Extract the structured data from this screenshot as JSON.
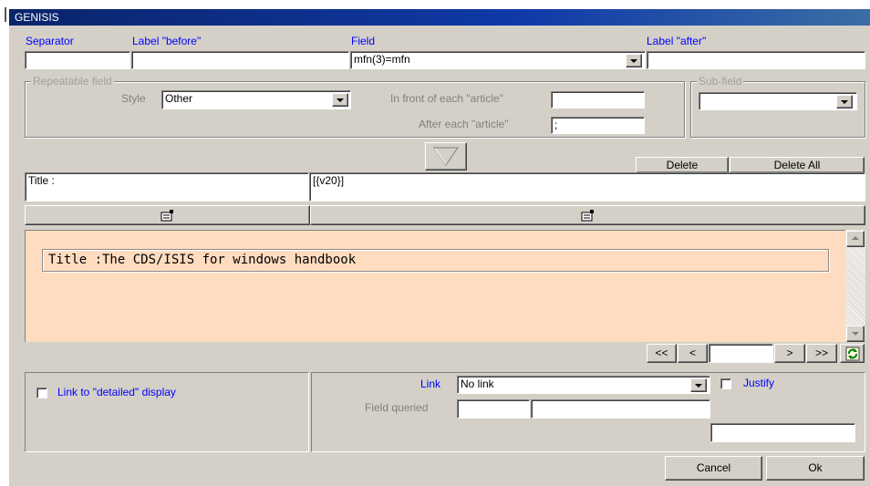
{
  "window": {
    "title": "GENISIS"
  },
  "labels": {
    "separator": "Separator",
    "label_before": "Label \"before\"",
    "field": "Field",
    "label_after": "Label \"after\""
  },
  "inputs": {
    "separator_value": "",
    "label_before_value": "",
    "field_value": "mfn(3)=mfn",
    "label_after_value": ""
  },
  "repeatable": {
    "legend": "Repeatable field",
    "style_label": "Style",
    "style_value": "Other",
    "in_front_label": "In front of each \"article\"",
    "in_front_value": "",
    "after_label": "After each \"article\"",
    "after_value": ";"
  },
  "subfield": {
    "legend": "Sub-field",
    "value": ""
  },
  "actions": {
    "delete": "Delete",
    "delete_all": "Delete All"
  },
  "row": {
    "label": "Title :",
    "format": "[{v20}]"
  },
  "preview": {
    "text": "Title :The CDS/ISIS for windows handbook"
  },
  "nav": {
    "first": "<<",
    "prev": "<",
    "page": "",
    "next": ">",
    "last": ">>"
  },
  "link": {
    "detailed_label": "Link to \"detailed\" display",
    "link_label": "Link",
    "link_value": "No link",
    "justify_label": "Justify",
    "field_queried_label": "Field queried",
    "fq1": "",
    "fq2": "",
    "extra": ""
  },
  "footer": {
    "cancel": "Cancel",
    "ok": "Ok"
  },
  "colors": {
    "title_bar": "#0a246a",
    "preview_bg": "#ffdcc0",
    "label_blue": "#0000ff",
    "dialog_bg": "#d4d0c8"
  }
}
